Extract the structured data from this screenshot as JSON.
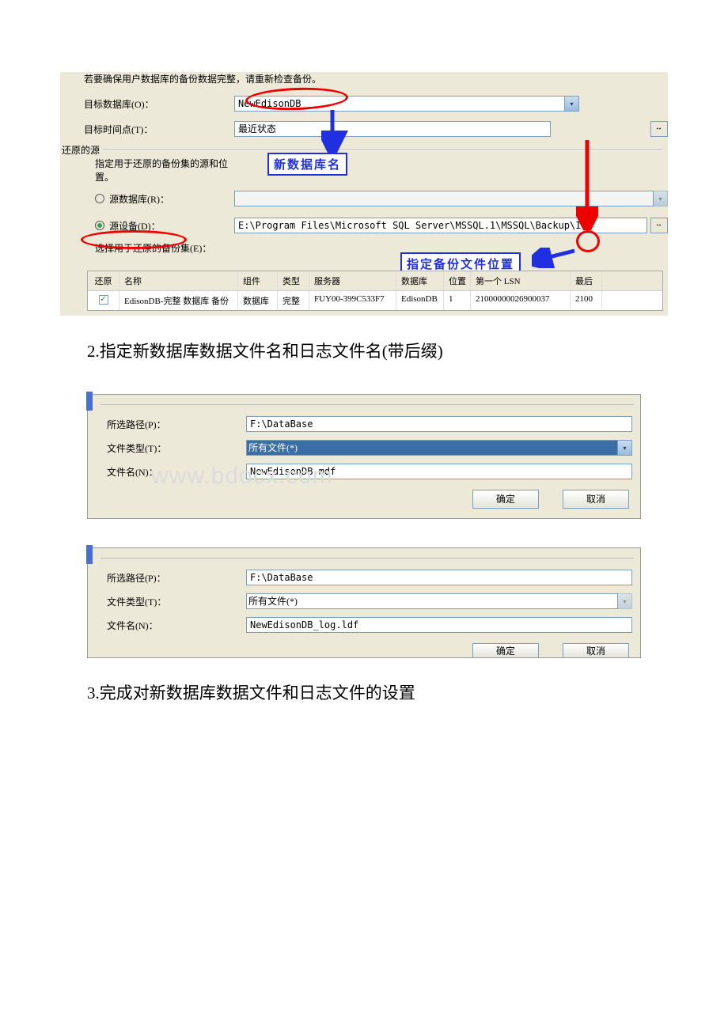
{
  "panel1": {
    "truncated_header": "若要确保用户数据库的备份数据完整，请重新检查备份。",
    "target_db_label": "目标数据库(O)：",
    "target_db_value": "NewEdisonDB",
    "target_time_label": "目标时间点(T)：",
    "target_time_value": "最近状态",
    "source_group": "还原的源",
    "source_hint": "指定用于还原的备份集的源和位置。",
    "radio_db_label": "源数据库(R)：",
    "radio_dev_label": "源设备(D)：",
    "device_path": "E:\\Program Files\\Microsoft SQL Server\\MSSQL.1\\MSSQL\\Backup\\I",
    "choose_set_label": "选择用于还原的备份集(E)：",
    "annot_newdb": "新数据库名",
    "annot_loc": "指定备份文件位置",
    "grid_headers": [
      "还原",
      "名称",
      "组件",
      "类型",
      "服务器",
      "数据库",
      "位置",
      "第一个 LSN",
      "最后"
    ],
    "grid_row": {
      "checked": true,
      "name": "EdisonDB-完整 数据库 备份",
      "component": "数据库",
      "type": "完整",
      "server": "FUY00-399C533F7",
      "database": "EdisonDB",
      "position": "1",
      "first_lsn": "21000000026900037",
      "last": "2100"
    }
  },
  "body_text_2": "2.指定新数据库数据文件名和日志文件名(带后缀)",
  "panel2": {
    "path_label": "所选路径(P)：",
    "path_value": "F:\\DataBase",
    "type_label": "文件类型(T)：",
    "type_value": "所有文件(*)",
    "name_label": "文件名(N)：",
    "name_value": "NewEdisonDB.mdf",
    "ok": "确定",
    "cancel": "取消"
  },
  "watermark": "www.bdocx.com",
  "panel3": {
    "path_label": "所选路径(P)：",
    "path_value": "F:\\DataBase",
    "type_label": "文件类型(T)：",
    "type_value": "所有文件(*)",
    "name_label": "文件名(N)：",
    "name_value": "NewEdisonDB_log.ldf",
    "ok": "确定",
    "cancel": "取消"
  },
  "body_text_3": "3.完成对新数据库数据文件和日志文件的设置"
}
